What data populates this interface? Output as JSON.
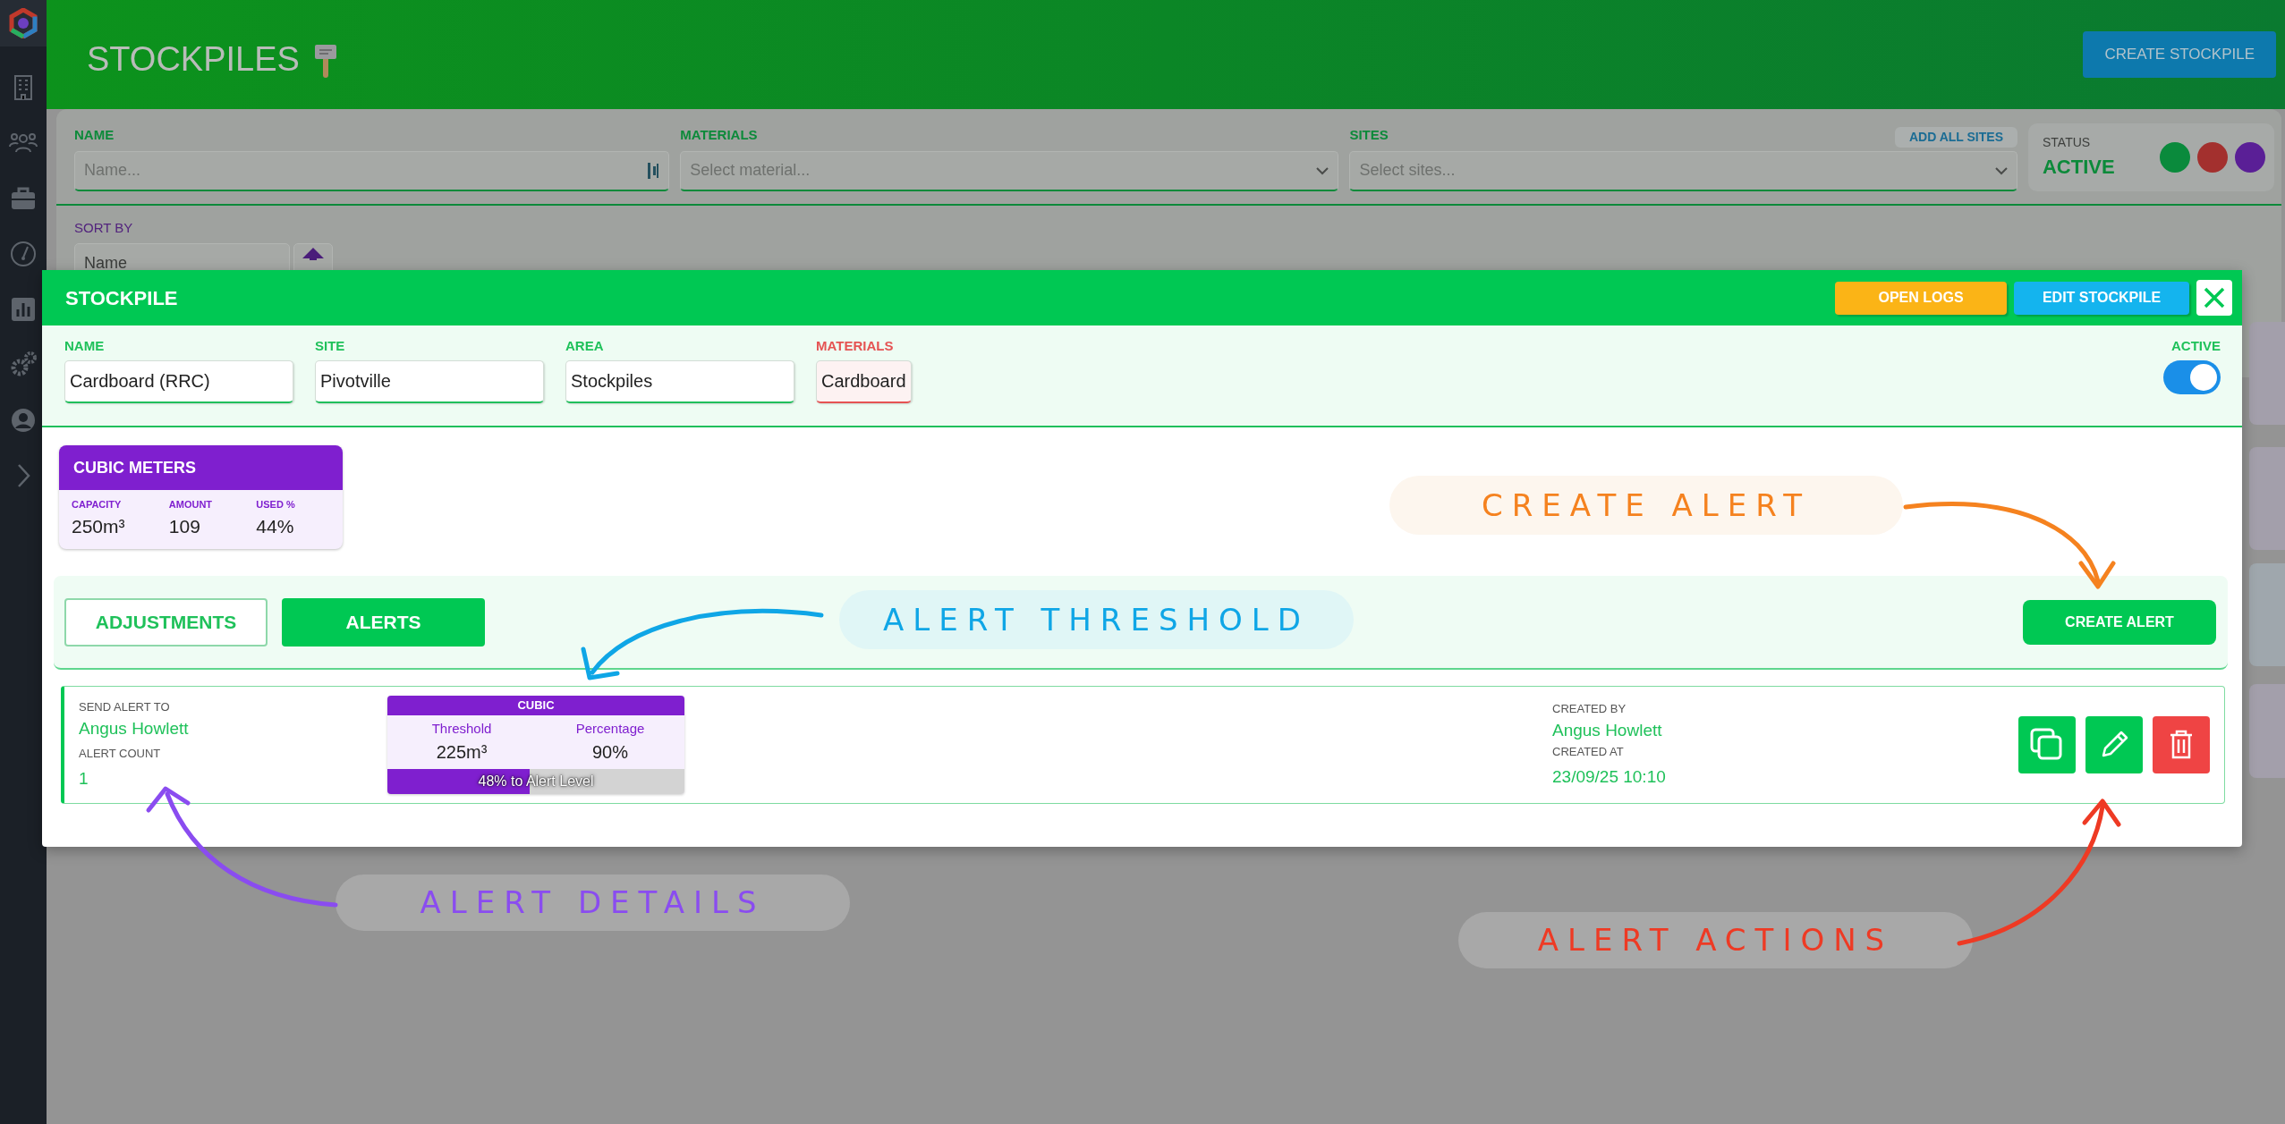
{
  "page": {
    "title": "STOCKPILES",
    "create_button": "CREATE STOCKPILE"
  },
  "filters": {
    "name": {
      "label": "NAME",
      "placeholder": "Name..."
    },
    "materials": {
      "label": "MATERIALS",
      "placeholder": "Select material..."
    },
    "sites": {
      "label": "SITES",
      "placeholder": "Select sites...",
      "add_all": "ADD ALL SITES"
    },
    "status": {
      "label": "STATUS",
      "value": "ACTIVE",
      "dots": [
        {
          "color": "#0a8a3c"
        },
        {
          "color": "#a3302e"
        },
        {
          "color": "#5a1f96"
        }
      ]
    },
    "sort": {
      "label": "SORT BY",
      "value": "Name"
    }
  },
  "modal": {
    "title": "STOCKPILE",
    "buttons": [
      {
        "label": "OPEN LOGS",
        "kind": "logs"
      },
      {
        "label": "EDIT STOCKPILE",
        "kind": "edit"
      }
    ],
    "fields": [
      {
        "label": "NAME",
        "value": "Cardboard (RRC)",
        "kind": "text"
      },
      {
        "label": "SITE",
        "value": "Pivotville",
        "kind": "text"
      },
      {
        "label": "AREA",
        "value": "Stockpiles",
        "kind": "text"
      },
      {
        "label": "MATERIALS",
        "value": "Cardboard",
        "kind": "material"
      }
    ],
    "active": {
      "label": "ACTIVE",
      "on": true
    },
    "metrics": {
      "title": "CUBIC METERS",
      "items": [
        {
          "label": "CAPACITY",
          "value": "250m³"
        },
        {
          "label": "AMOUNT",
          "value": "109"
        },
        {
          "label": "USED %",
          "value": "44%"
        }
      ]
    },
    "tabs": [
      {
        "label": "ADJUSTMENTS",
        "selected": false
      },
      {
        "label": "ALERTS",
        "selected": true
      }
    ],
    "create_alert": "CREATE ALERT",
    "alerts": [
      {
        "send_to_label": "SEND ALERT TO",
        "send_to": "Angus Howlett",
        "count_label": "ALERT COUNT",
        "count": "1",
        "threshold": {
          "title": "CUBIC",
          "columns": [
            {
              "label": "Threshold",
              "value": "225m³"
            },
            {
              "label": "Percentage",
              "value": "90%"
            }
          ],
          "level": 0.48,
          "progress_text": "48% to Alert Level"
        },
        "created_by_label": "CREATED BY",
        "created_by": "Angus Howlett",
        "created_at_label": "CREATED AT",
        "created_at": "23/09/25 10:10"
      }
    ]
  },
  "annotations": [
    {
      "text": "CREATE ALERT",
      "color": "#f5821f"
    },
    {
      "text": "ALERT THRESHOLD",
      "color": "#0fa6e6"
    },
    {
      "text": "ALERT DETAILS",
      "color": "#8a4cf0"
    },
    {
      "text": "ALERT ACTIONS",
      "color": "#ee3a24"
    }
  ]
}
